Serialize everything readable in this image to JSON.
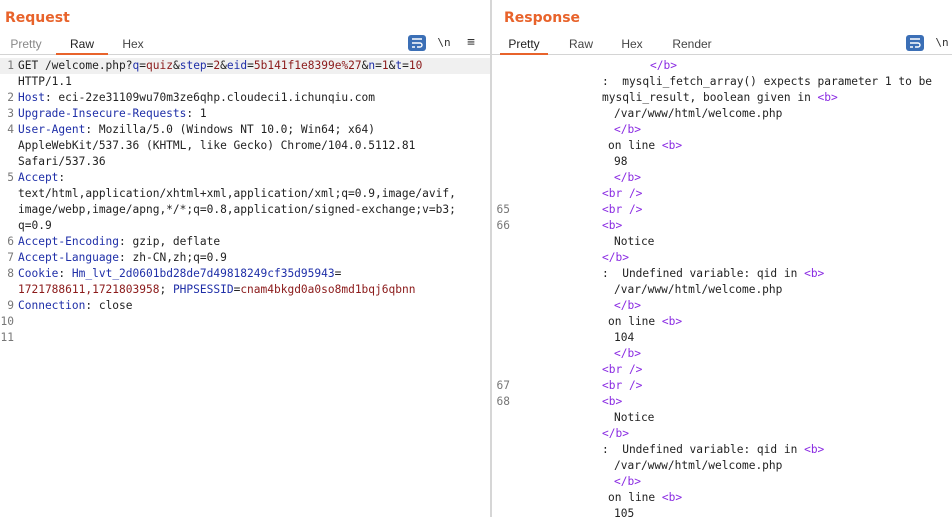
{
  "request": {
    "title": "Request",
    "tabs": [
      "Pretty",
      "Raw",
      "Hex"
    ],
    "active_tab": "Raw",
    "newline_label": "\\n",
    "menu_glyph": "≡",
    "lines": [
      {
        "n": "1",
        "segs": [
          [
            "GET /welcome.php?",
            "t"
          ],
          [
            "q",
            "k"
          ],
          [
            "=",
            "t"
          ],
          [
            "quiz",
            "v"
          ],
          [
            "&",
            "t"
          ],
          [
            "step",
            "k"
          ],
          [
            "=",
            "t"
          ],
          [
            "2",
            "v"
          ],
          [
            "&",
            "t"
          ],
          [
            "eid",
            "k"
          ],
          [
            "=",
            "t"
          ],
          [
            "5b141f1e8399e%27",
            "v"
          ],
          [
            "&",
            "t"
          ],
          [
            "n",
            "k"
          ],
          [
            "=",
            "t"
          ],
          [
            "1",
            "v"
          ],
          [
            "&",
            "t"
          ],
          [
            "t",
            "k"
          ],
          [
            "=",
            "t"
          ],
          [
            "10",
            "v"
          ]
        ]
      },
      {
        "n": "",
        "segs": [
          [
            "HTTP/1.1",
            "t"
          ]
        ]
      },
      {
        "n": "2",
        "segs": [
          [
            "Host",
            "k"
          ],
          [
            ": eci-2ze31109wu70m3ze6qhp.cloudeci1.ichunqiu.com",
            "t"
          ]
        ]
      },
      {
        "n": "3",
        "segs": [
          [
            "Upgrade-Insecure-Requests",
            "k"
          ],
          [
            ": 1",
            "t"
          ]
        ]
      },
      {
        "n": "4",
        "segs": [
          [
            "User-Agent",
            "k"
          ],
          [
            ": Mozilla/5.0 (Windows NT 10.0; Win64; x64)",
            "t"
          ]
        ]
      },
      {
        "n": "",
        "segs": [
          [
            "AppleWebKit/537.36 (KHTML, like Gecko) Chrome/104.0.5112.81",
            "t"
          ]
        ]
      },
      {
        "n": "",
        "segs": [
          [
            "Safari/537.36",
            "t"
          ]
        ]
      },
      {
        "n": "5",
        "segs": [
          [
            "Accept",
            "k"
          ],
          [
            ":",
            "t"
          ]
        ]
      },
      {
        "n": "",
        "segs": [
          [
            "text/html,application/xhtml+xml,application/xml;q=0.9,image/avif,",
            "t"
          ]
        ]
      },
      {
        "n": "",
        "segs": [
          [
            "image/webp,image/apng,*/*;q=0.8,application/signed-exchange;v=b3;",
            "t"
          ]
        ]
      },
      {
        "n": "",
        "segs": [
          [
            "q=0.9",
            "t"
          ]
        ]
      },
      {
        "n": "6",
        "segs": [
          [
            "Accept-Encoding",
            "k"
          ],
          [
            ": gzip, deflate",
            "t"
          ]
        ]
      },
      {
        "n": "7",
        "segs": [
          [
            "Accept-Language",
            "k"
          ],
          [
            ": zh-CN,zh;q=0.9",
            "t"
          ]
        ]
      },
      {
        "n": "8",
        "segs": [
          [
            "Cookie",
            "k"
          ],
          [
            ": ",
            "t"
          ],
          [
            "Hm_lvt_2d0601bd28de7d49818249cf35d95943",
            "k"
          ],
          [
            "=",
            "t"
          ]
        ]
      },
      {
        "n": "",
        "segs": [
          [
            "1721788611,1721803958",
            "v"
          ],
          [
            "; ",
            "t"
          ],
          [
            "PHPSESSID",
            "k"
          ],
          [
            "=",
            "t"
          ],
          [
            "cnam4bkgd0a0so8md1bqj6qbnn",
            "v"
          ]
        ]
      },
      {
        "n": "9",
        "segs": [
          [
            "Connection",
            "k"
          ],
          [
            ": close",
            "t"
          ]
        ]
      },
      {
        "n": "10",
        "segs": []
      },
      {
        "n": "11",
        "segs": []
      }
    ]
  },
  "response": {
    "title": "Response",
    "tabs": [
      "Pretty",
      "Raw",
      "Hex",
      "Render"
    ],
    "active_tab": "Pretty",
    "newline_label": "\\n",
    "lines": [
      {
        "n": "",
        "ind": 8,
        "segs": [
          [
            "</b>",
            "g"
          ]
        ]
      },
      {
        "n": "",
        "ind": 0,
        "segs": [
          [
            ":  mysqli_fetch_array() expects parameter 1 to be",
            "t"
          ]
        ]
      },
      {
        "n": "",
        "ind": 0,
        "segs": [
          [
            "mysqli_result, boolean given in ",
            "t"
          ],
          [
            "<b>",
            "g"
          ]
        ]
      },
      {
        "n": "",
        "ind": 2,
        "segs": [
          [
            "/var/www/html/welcome.php",
            "t"
          ]
        ]
      },
      {
        "n": "",
        "ind": 2,
        "segs": [
          [
            "</b>",
            "g"
          ]
        ]
      },
      {
        "n": "",
        "ind": 1,
        "segs": [
          [
            "on line ",
            "t"
          ],
          [
            "<b>",
            "g"
          ]
        ]
      },
      {
        "n": "",
        "ind": 2,
        "segs": [
          [
            "98",
            "t"
          ]
        ]
      },
      {
        "n": "",
        "ind": 2,
        "segs": [
          [
            "</b>",
            "g"
          ]
        ]
      },
      {
        "n": "",
        "ind": 0,
        "segs": [
          [
            "<br />",
            "g"
          ]
        ]
      },
      {
        "n": "65",
        "ind": 0,
        "segs": [
          [
            "<br />",
            "g"
          ]
        ]
      },
      {
        "n": "66",
        "ind": 0,
        "segs": [
          [
            "<b>",
            "g"
          ]
        ]
      },
      {
        "n": "",
        "ind": 2,
        "segs": [
          [
            "Notice",
            "t"
          ]
        ]
      },
      {
        "n": "",
        "ind": 0,
        "segs": [
          [
            "</b>",
            "g"
          ]
        ]
      },
      {
        "n": "",
        "ind": 0,
        "segs": [
          [
            ":  Undefined variable: qid in ",
            "t"
          ],
          [
            "<b>",
            "g"
          ]
        ]
      },
      {
        "n": "",
        "ind": 2,
        "segs": [
          [
            "/var/www/html/welcome.php",
            "t"
          ]
        ]
      },
      {
        "n": "",
        "ind": 2,
        "segs": [
          [
            "</b>",
            "g"
          ]
        ]
      },
      {
        "n": "",
        "ind": 1,
        "segs": [
          [
            "on line ",
            "t"
          ],
          [
            "<b>",
            "g"
          ]
        ]
      },
      {
        "n": "",
        "ind": 2,
        "segs": [
          [
            "104",
            "t"
          ]
        ]
      },
      {
        "n": "",
        "ind": 2,
        "segs": [
          [
            "</b>",
            "g"
          ]
        ]
      },
      {
        "n": "",
        "ind": 0,
        "segs": [
          [
            "<br />",
            "g"
          ]
        ]
      },
      {
        "n": "67",
        "ind": 0,
        "segs": [
          [
            "<br />",
            "g"
          ]
        ]
      },
      {
        "n": "68",
        "ind": 0,
        "segs": [
          [
            "<b>",
            "g"
          ]
        ]
      },
      {
        "n": "",
        "ind": 2,
        "segs": [
          [
            "Notice",
            "t"
          ]
        ]
      },
      {
        "n": "",
        "ind": 0,
        "segs": [
          [
            "</b>",
            "g"
          ]
        ]
      },
      {
        "n": "",
        "ind": 0,
        "segs": [
          [
            ":  Undefined variable: qid in ",
            "t"
          ],
          [
            "<b>",
            "g"
          ]
        ]
      },
      {
        "n": "",
        "ind": 2,
        "segs": [
          [
            "/var/www/html/welcome.php",
            "t"
          ]
        ]
      },
      {
        "n": "",
        "ind": 2,
        "segs": [
          [
            "</b>",
            "g"
          ]
        ]
      },
      {
        "n": "",
        "ind": 1,
        "segs": [
          [
            "on line ",
            "t"
          ],
          [
            "<b>",
            "g"
          ]
        ]
      },
      {
        "n": "",
        "ind": 2,
        "segs": [
          [
            "105",
            "t"
          ]
        ]
      }
    ]
  },
  "colors": {
    "accent": "#e8632b",
    "header_key": "#1f2fa8",
    "param_value": "#8b1a1a",
    "html_tag": "#8a2be2",
    "icon_blue": "#3b6fb6"
  },
  "icons": {
    "wrap": "wrap-lines-icon",
    "newline": "show-newlines-icon",
    "menu": "hamburger-menu-icon",
    "layout": "layout-toggle-icon"
  }
}
